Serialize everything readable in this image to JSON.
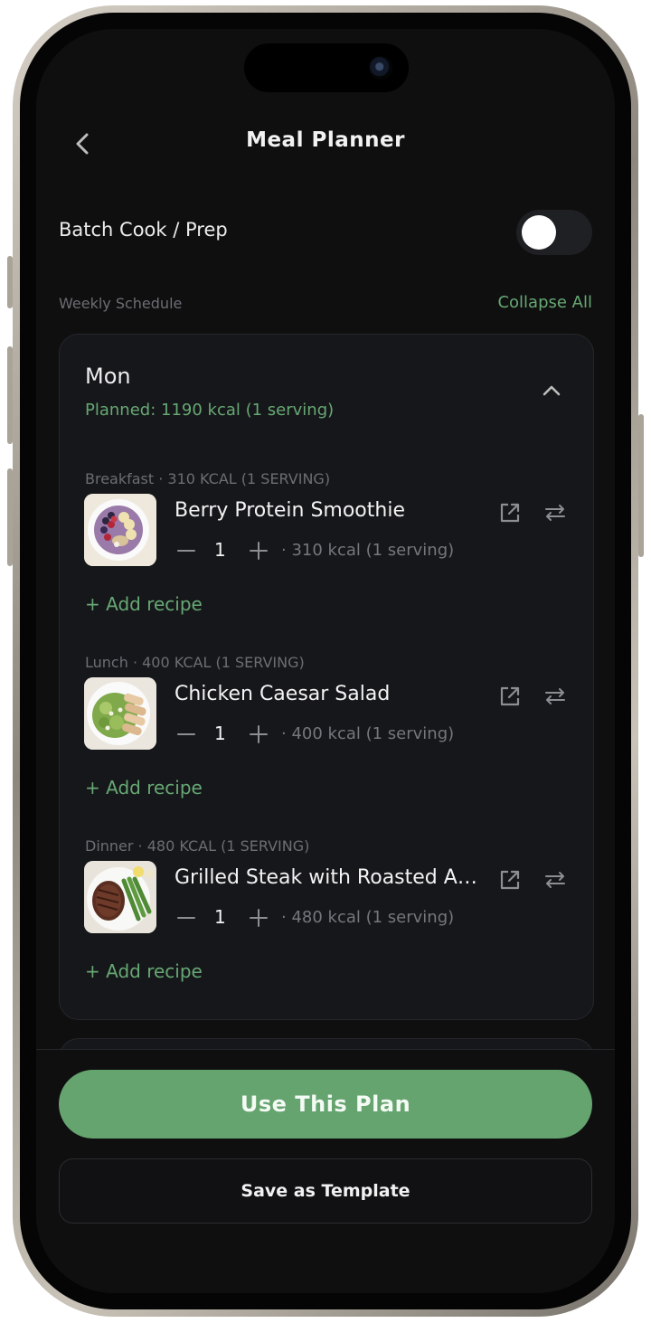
{
  "header": {
    "title": "Meal Planner",
    "back_icon": "chevron-left-icon"
  },
  "batch": {
    "label": "Batch Cook / Prep",
    "toggle_on": false
  },
  "schedule": {
    "label": "Weekly Schedule",
    "collapse_label": "Collapse All"
  },
  "day": {
    "name": "Mon",
    "planned": "Planned: 1190 kcal (1 serving)",
    "expanded": true,
    "meals": [
      {
        "label": "Breakfast · 310 KCAL (1 SERVING)",
        "recipe": "Berry Protein Smoothie",
        "qty": "1",
        "kcal": "· 310 kcal (1 serving)",
        "add": "+ Add recipe",
        "thumb": "smoothie-bowl-image"
      },
      {
        "label": "Lunch · 400 KCAL (1 SERVING)",
        "recipe": "Chicken Caesar Salad",
        "qty": "1",
        "kcal": "· 400 kcal (1 serving)",
        "add": "+ Add recipe",
        "thumb": "caesar-salad-image"
      },
      {
        "label": "Dinner · 480 KCAL (1 SERVING)",
        "recipe": "Grilled Steak with Roasted Asparagus",
        "qty": "1",
        "kcal": "· 480 kcal (1 serving)",
        "add": "+ Add recipe",
        "thumb": "steak-asparagus-image"
      }
    ]
  },
  "footer": {
    "primary": "Use This Plan",
    "secondary": "Save as Template"
  },
  "colors": {
    "accent": "#67a874",
    "button": "#65a36f",
    "background": "#0f0f10",
    "card": "#16171a"
  }
}
